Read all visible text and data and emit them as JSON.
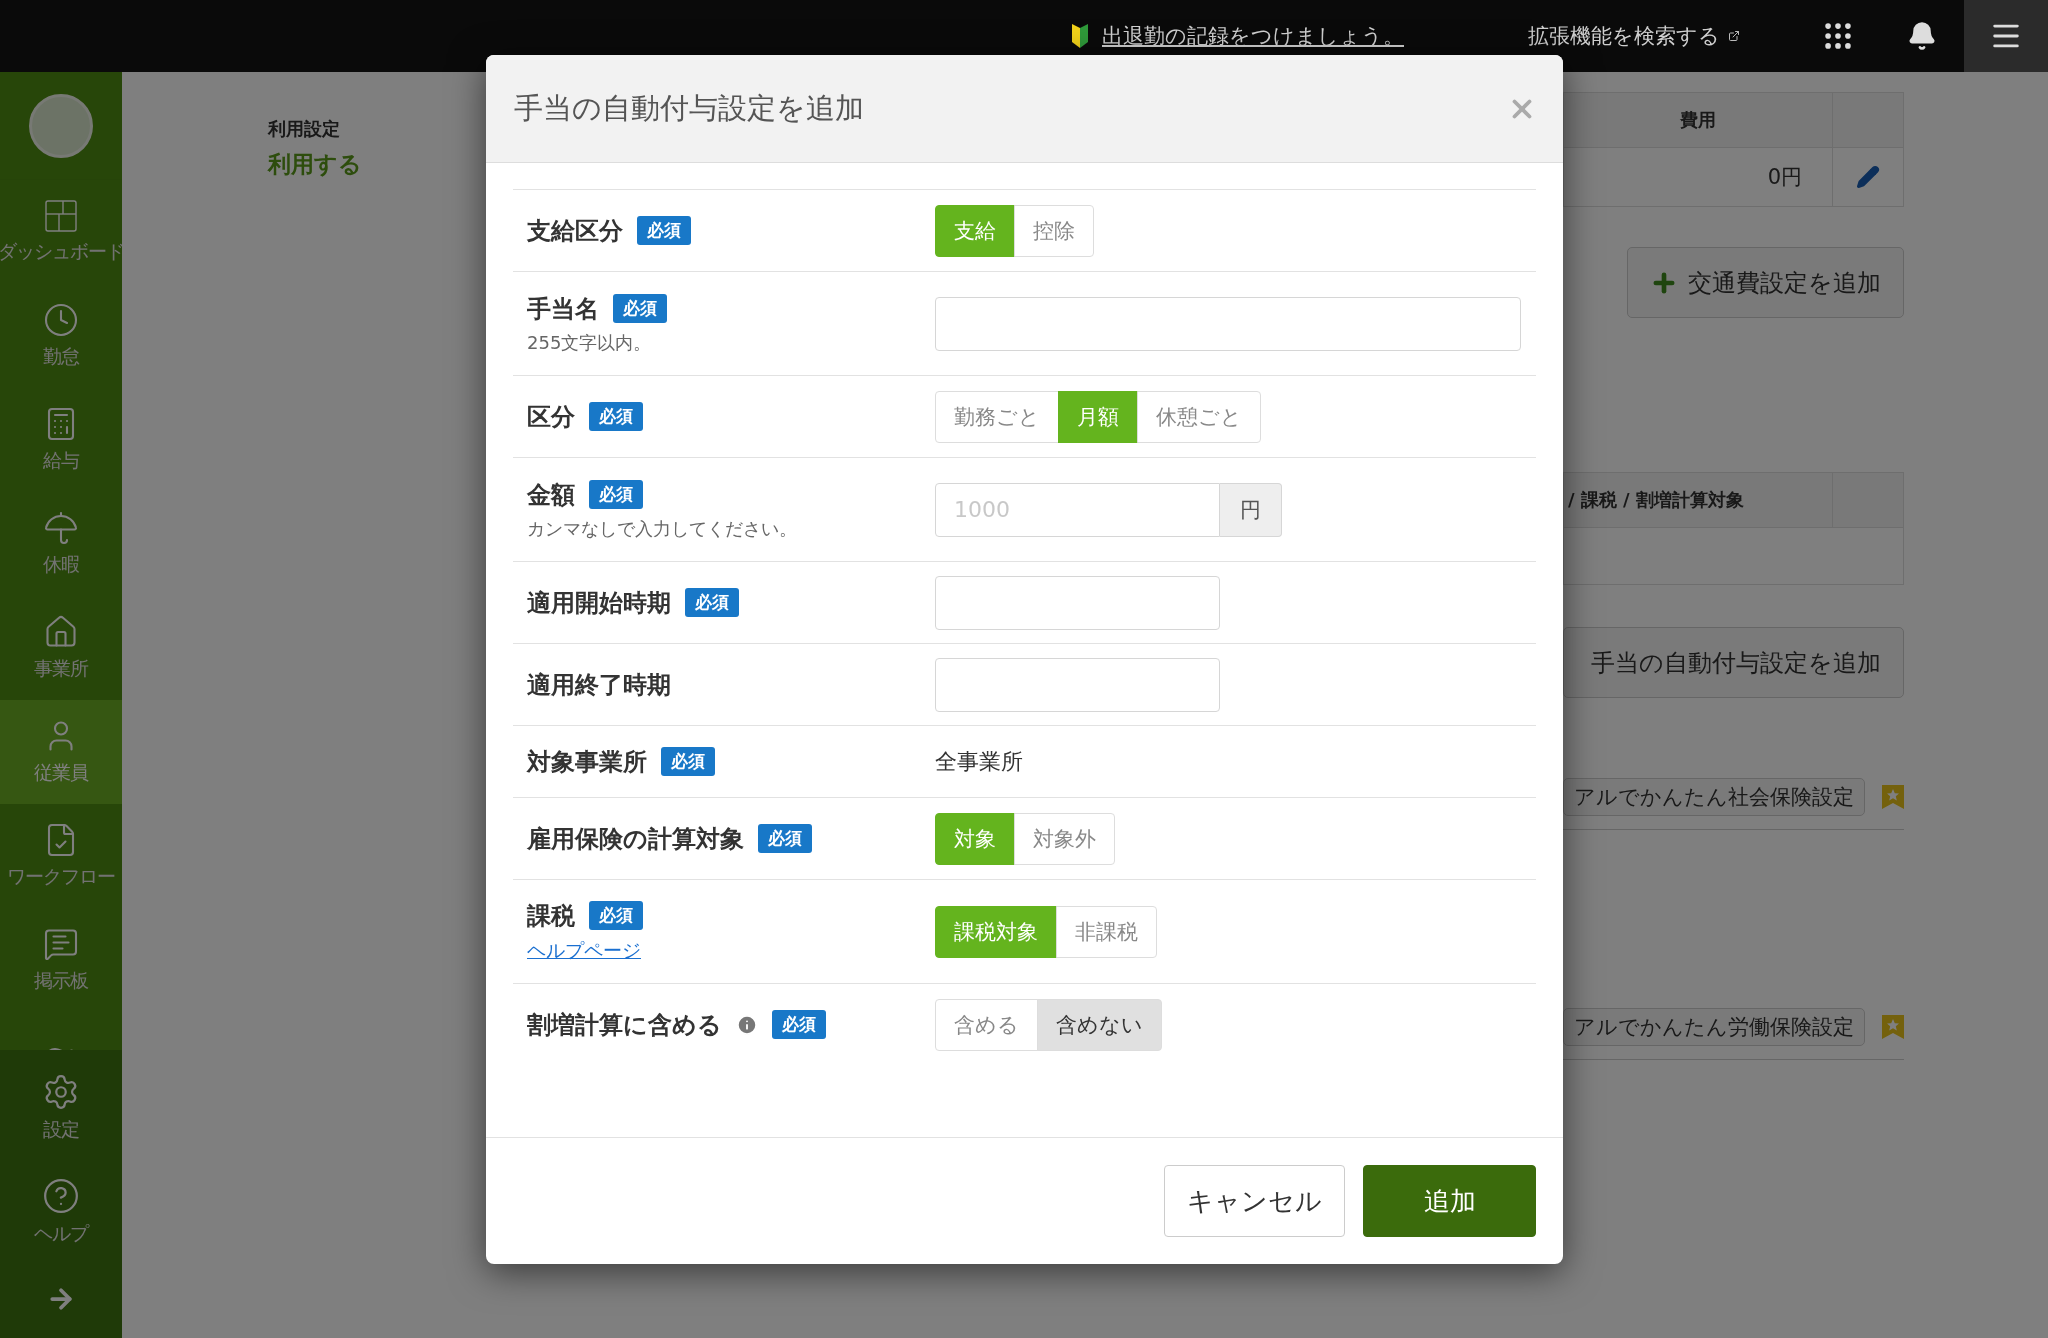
{
  "top_bar": {
    "notice_link": "出退勤の記録をつけましょう。",
    "extension_search": "拡張機能を検索する"
  },
  "sidebar": {
    "items": [
      {
        "label": "ダッシュボード",
        "selected": false
      },
      {
        "label": "勤怠",
        "selected": false
      },
      {
        "label": "給与",
        "selected": false
      },
      {
        "label": "休暇",
        "selected": false
      },
      {
        "label": "事業所",
        "selected": false
      },
      {
        "label": "従業員",
        "selected": true
      },
      {
        "label": "ワークフロー",
        "selected": false
      },
      {
        "label": "掲示板",
        "selected": false
      }
    ],
    "bottom_items": [
      {
        "label": "設定"
      },
      {
        "label": "ヘルプ"
      }
    ]
  },
  "page": {
    "usage_label": "利用設定",
    "usage_value": "利用する",
    "commute_table": {
      "columns": [
        "費用"
      ],
      "rows": [
        [
          "0円"
        ]
      ]
    },
    "add_commute_button": "交通費設定を追加",
    "allowance_table": {
      "columns": [
        "/ 課税 / 割増計算対象"
      ]
    },
    "add_allowance_button": "手当の自動付与設定を追加",
    "manual_links": [
      "アルでかんたん社会保険設定",
      "アルでかんたん労働保険設定"
    ]
  },
  "modal": {
    "title": "手当の自動付与設定を追加",
    "fields": [
      {
        "kind": "choice",
        "label": "支給区分",
        "badge": "必須",
        "options": [
          {
            "label": "支給",
            "selected": true
          },
          {
            "label": "控除",
            "selected": false
          }
        ]
      },
      {
        "kind": "text",
        "label": "手当名",
        "badge": "必須",
        "hint": "255文字以内。"
      },
      {
        "kind": "choice",
        "label": "区分",
        "badge": "必須",
        "options": [
          {
            "label": "勤務ごと",
            "selected": false
          },
          {
            "label": "月額",
            "selected": true
          },
          {
            "label": "休憩ごと",
            "selected": false
          }
        ]
      },
      {
        "kind": "amount",
        "label": "金額",
        "badge": "必須",
        "hint": "カンマなしで入力してください。",
        "placeholder": "1000",
        "unit": "円"
      },
      {
        "kind": "date",
        "label": "適用開始時期",
        "badge": "必須"
      },
      {
        "kind": "date",
        "label": "適用終了時期"
      },
      {
        "kind": "static",
        "label": "対象事業所",
        "badge": "必須",
        "value": "全事業所"
      },
      {
        "kind": "choice",
        "label": "雇用保険の計算対象",
        "badge": "必須",
        "options": [
          {
            "label": "対象",
            "selected": true
          },
          {
            "label": "対象外",
            "selected": false
          }
        ]
      },
      {
        "kind": "choice",
        "label": "課税",
        "badge": "必須",
        "link": "ヘルプページ",
        "options": [
          {
            "label": "課税対象",
            "selected": true
          },
          {
            "label": "非課税",
            "selected": false
          }
        ]
      },
      {
        "kind": "toggle",
        "label": "割増計算に含める",
        "info": true,
        "badge": "必須",
        "options": [
          {
            "label": "含める",
            "selected": false
          },
          {
            "label": "含めない",
            "selected": true
          }
        ]
      }
    ],
    "buttons": [
      {
        "label": "キャンセル",
        "kind": "secondary"
      },
      {
        "label": "追加",
        "kind": "primary"
      }
    ]
  }
}
